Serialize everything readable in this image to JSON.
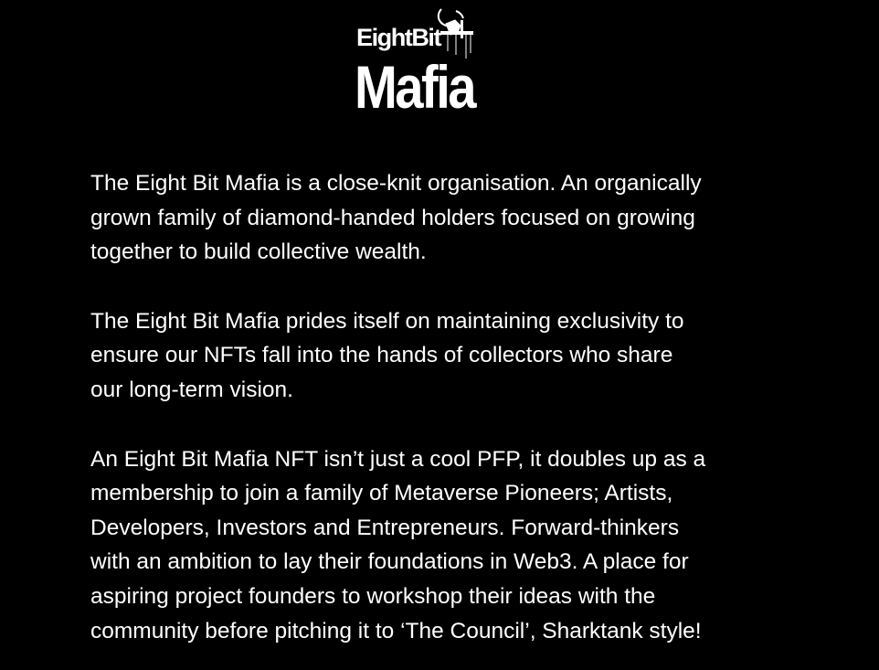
{
  "logo": {
    "line1": "EightBit",
    "line2": "Mafia",
    "color": "#ffffff"
  },
  "paragraphs": [
    {
      "lines": [
        "The Eight Bit Mafia is a close-knit organisation. An organically",
        "grown family of diamond-handed holders focused on growing",
        "together to build collective wealth."
      ]
    },
    {
      "lines": [
        "The Eight Bit Mafia prides itself on maintaining exclusivity to",
        "ensure our NFTs fall into the hands of collectors who share",
        "our long-term vision."
      ]
    },
    {
      "lines": [
        "An Eight Bit Mafia NFT isn’t just a cool PFP, it doubles up as a",
        "membership to join a family of Metaverse Pioneers; Artists,",
        "Developers, Investors and Entrepreneurs. Forward-thinkers",
        "with an ambition to lay their foundations in Web3. A place for",
        "aspiring project founders to workshop their ideas with the",
        "community before pitching it to ‘The Council’, Sharktank style!"
      ]
    }
  ],
  "colors": {
    "background": "#000000",
    "text": "#ffffff"
  }
}
